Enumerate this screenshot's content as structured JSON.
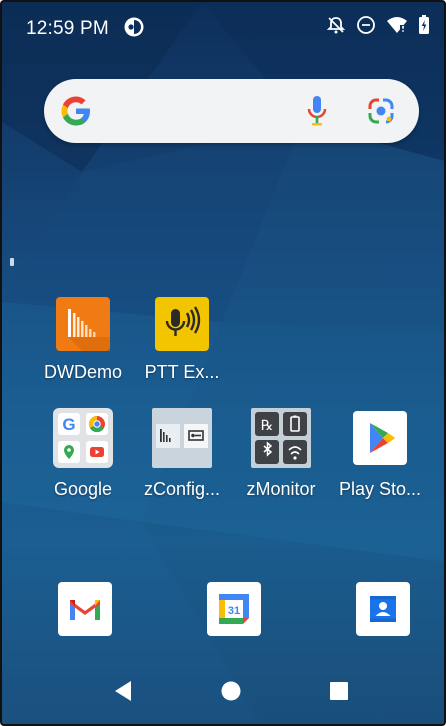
{
  "status_bar": {
    "time": "12:59 PM",
    "icons": [
      "notification-app-icon",
      "notifications-muted-icon",
      "do-not-disturb-icon",
      "wifi-icon",
      "battery-icon"
    ]
  },
  "search_bar": {
    "icons": [
      "google-g-icon",
      "microphone-icon",
      "google-lens-icon"
    ]
  },
  "apps": {
    "row1": [
      {
        "label": "DWDemo",
        "icon": "dwdemo-icon",
        "color": "#f07a13"
      },
      {
        "label": "PTT Ex...",
        "icon": "ptt-express-icon",
        "color": "#f2c500"
      }
    ],
    "row2": [
      {
        "label": "Google",
        "icon": "google-folder-icon"
      },
      {
        "label": "zConfig...",
        "icon": "zconfigure-icon"
      },
      {
        "label": "zMonitor",
        "icon": "zmonitor-icon"
      },
      {
        "label": "Play Sto...",
        "icon": "play-store-icon"
      }
    ]
  },
  "dock": {
    "items": [
      "gmail-icon",
      "google-calendar-icon",
      "contacts-icon"
    ],
    "calendar_day": "31"
  },
  "nav_bar": {
    "buttons": [
      "back-button",
      "home-button",
      "recents-button"
    ]
  },
  "colors": {
    "google_blue": "#4285f4",
    "google_red": "#ea4335",
    "google_yellow": "#fbbc05",
    "google_green": "#34a853"
  }
}
